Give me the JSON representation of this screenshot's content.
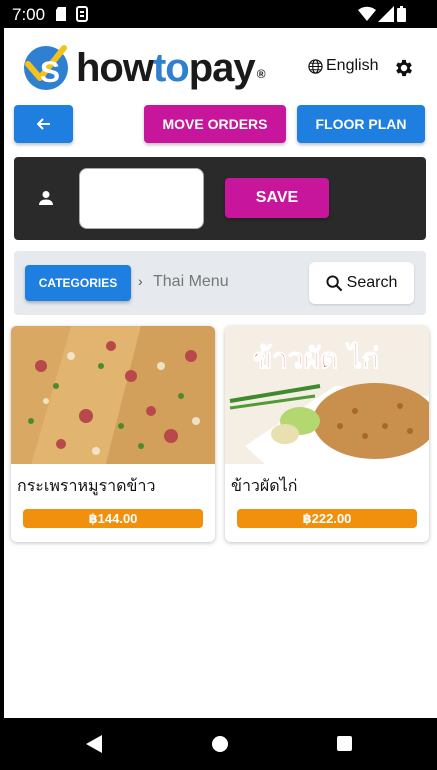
{
  "status_bar": {
    "time": "7:00"
  },
  "header": {
    "logo_text_a": "S",
    "logo_how": "how",
    "logo_to": "to",
    "logo_pay": "pay",
    "logo_reg": "®",
    "language": "English"
  },
  "toolbar": {
    "move_orders_label": "MOVE ORDERS",
    "floor_plan_label": "FLOOR PLAN"
  },
  "order_panel": {
    "name_value": "",
    "save_label": "SAVE"
  },
  "category_bar": {
    "categories_label": "CATEGORIES",
    "separator": "›",
    "current_category": "Thai Menu",
    "search_label": "Search"
  },
  "menu_items": [
    {
      "name": "กระเพราหมูราดข้าว",
      "price": "฿144.00"
    },
    {
      "name": "ข้าวผัดไก่",
      "price": "฿222.00",
      "image_caption": "ข้าวผัด ไก่"
    }
  ],
  "colors": {
    "primary_blue": "#1e7fe0",
    "magenta": "#c8169c",
    "price_orange": "#f0900c",
    "panel_dark": "#2a2a2a"
  }
}
